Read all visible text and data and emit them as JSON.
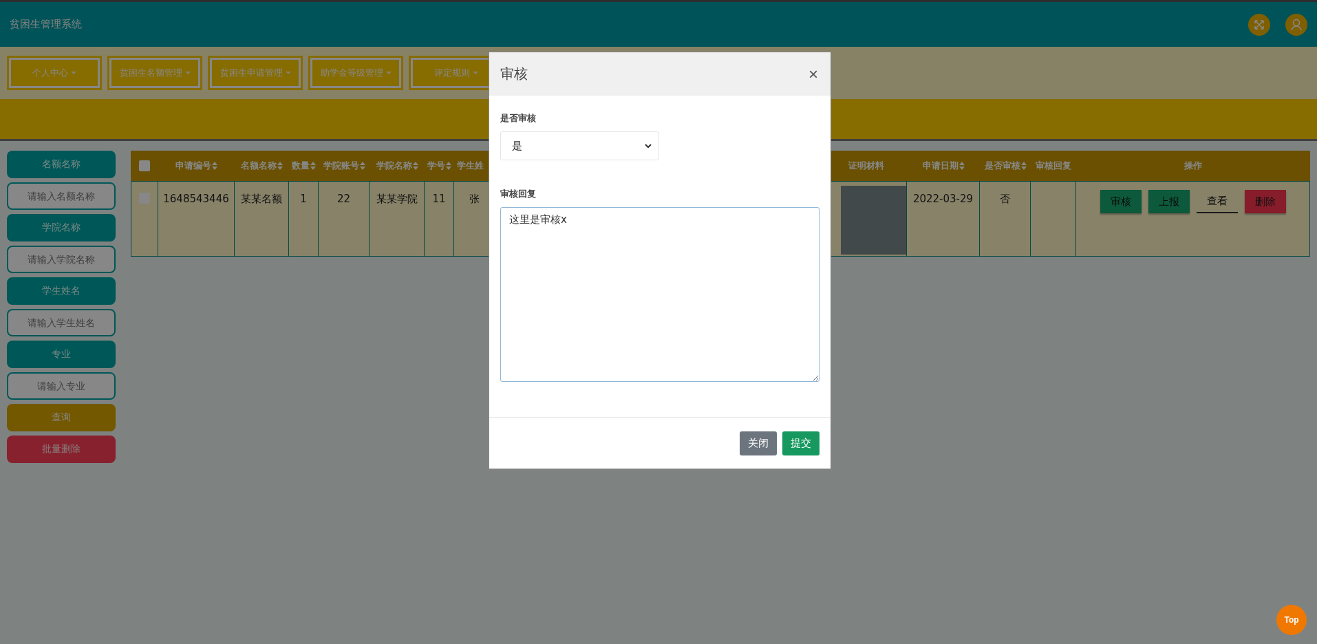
{
  "app_title": "贫困生管理系统",
  "nav": [
    {
      "label": "个人中心"
    },
    {
      "label": "贫困生名额管理"
    },
    {
      "label": "贫困生申请管理"
    },
    {
      "label": "助学金等级管理"
    },
    {
      "label": "评定规则"
    }
  ],
  "sidebar": [
    {
      "kind": "label",
      "text": "名额名称"
    },
    {
      "kind": "input",
      "placeholder": "请输入名额名称"
    },
    {
      "kind": "label",
      "text": "学院名称"
    },
    {
      "kind": "input",
      "placeholder": "请输入学院名称"
    },
    {
      "kind": "label",
      "text": "学生姓名"
    },
    {
      "kind": "input",
      "placeholder": "请输入学生姓名"
    },
    {
      "kind": "label",
      "text": "专业"
    },
    {
      "kind": "input",
      "placeholder": "请输入专业"
    },
    {
      "kind": "search",
      "text": "查询"
    },
    {
      "kind": "danger",
      "text": "批量删除"
    }
  ],
  "table": {
    "select_all_checked": false,
    "columns": [
      {
        "label": "申请编号",
        "sortable": true
      },
      {
        "label": "名额名称",
        "sortable": true
      },
      {
        "label": "数量",
        "sortable": true
      },
      {
        "label": "学院账号",
        "sortable": true
      },
      {
        "label": "学院名称",
        "sortable": true
      },
      {
        "label": "学号",
        "sortable": true
      },
      {
        "label": "学生姓",
        "sortable": false
      },
      {
        "label": "证明材料",
        "sortable": false
      },
      {
        "label": "申请日期",
        "sortable": true
      },
      {
        "label": "是否审核",
        "sortable": true
      },
      {
        "label": "审核回复",
        "sortable": false
      },
      {
        "label": "操作",
        "sortable": false
      }
    ],
    "rows": [
      {
        "checked": false,
        "cells": [
          {
            "kind": "text",
            "text": "1648543446"
          },
          {
            "kind": "text",
            "text": "某某名额"
          },
          {
            "kind": "text",
            "text": "1"
          },
          {
            "kind": "text",
            "text": "22"
          },
          {
            "kind": "text",
            "text": "某某学院"
          },
          {
            "kind": "text",
            "text": "11"
          },
          {
            "kind": "partial",
            "text": "张"
          },
          {
            "kind": "photo"
          },
          {
            "kind": "text",
            "text": "2022-03-29"
          },
          {
            "kind": "text",
            "text": "否"
          },
          {
            "kind": "empty"
          },
          {
            "kind": "actions",
            "buttons": [
              {
                "kind": "review",
                "label": "审核"
              },
              {
                "kind": "report",
                "label": "上报"
              },
              {
                "kind": "view",
                "label": "查看"
              },
              {
                "kind": "delete",
                "label": "删除"
              }
            ]
          }
        ]
      }
    ]
  },
  "modal": {
    "title": "审核",
    "close": "×",
    "fields": [
      {
        "kind": "select",
        "label": "是否审核",
        "value": "是"
      },
      {
        "kind": "textarea",
        "label": "审核回复",
        "value": "这里是审核x"
      }
    ],
    "buttons": [
      {
        "kind": "secondary",
        "label": "关闭"
      },
      {
        "kind": "primary",
        "label": "提交"
      }
    ]
  },
  "back_to_top": "Top"
}
